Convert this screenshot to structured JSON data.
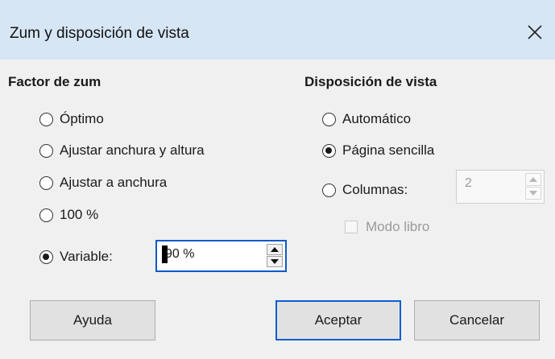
{
  "window": {
    "title": "Zum y disposición de vista",
    "close_icon": "close-icon"
  },
  "zoom_factor": {
    "title": "Factor de zum",
    "options": [
      {
        "label": "Óptimo",
        "checked": false
      },
      {
        "label": "Ajustar anchura y altura",
        "checked": false
      },
      {
        "label": "Ajustar a anchura",
        "checked": false
      },
      {
        "label": "100 %",
        "checked": false
      },
      {
        "label": "Variable:",
        "checked": true
      }
    ],
    "variable_value": "90 %"
  },
  "view_layout": {
    "title": "Disposición de vista",
    "options": [
      {
        "label": "Automático",
        "checked": false
      },
      {
        "label": "Página sencilla",
        "checked": true
      },
      {
        "label": "Columnas:",
        "checked": false
      }
    ],
    "columns_value": "2",
    "book_mode_label": "Modo libro",
    "book_mode_checked": false,
    "book_mode_enabled": false
  },
  "buttons": {
    "help": "Ayuda",
    "ok": "Aceptar",
    "cancel": "Cancelar"
  },
  "colors": {
    "titlebar": "#d6e6f5",
    "background": "#f0f0f0",
    "focus_border": "#0c59c9"
  }
}
